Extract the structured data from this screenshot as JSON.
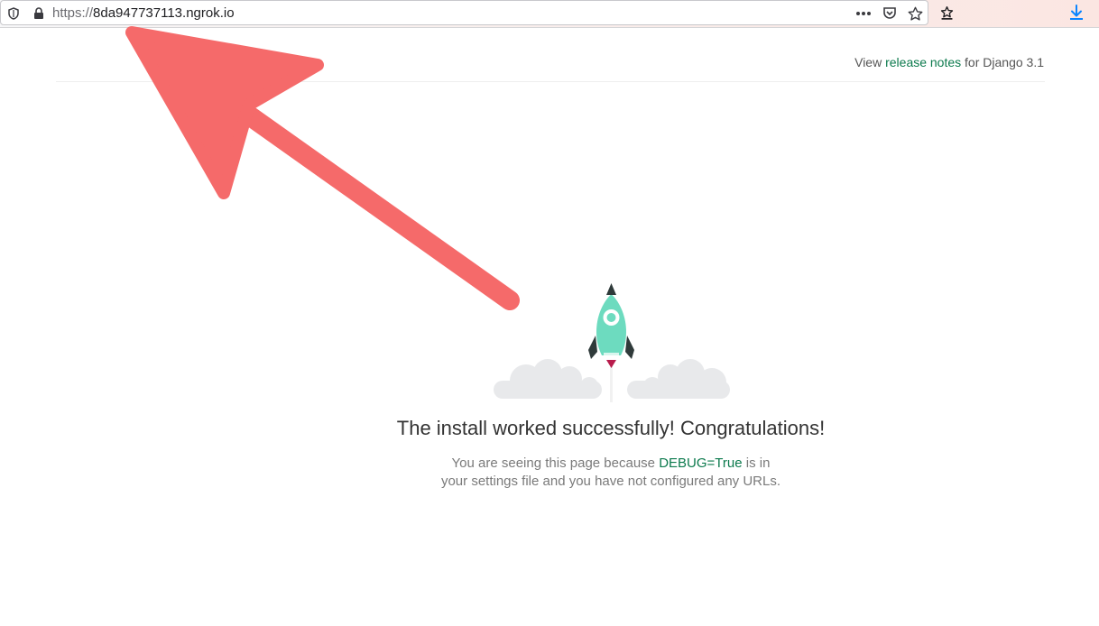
{
  "browser": {
    "url_scheme": "https://",
    "url_host": "8da947737113.ngrok.io",
    "icons": [
      "shield-icon",
      "lock-icon",
      "more-actions-icon",
      "pocket-icon",
      "bookmark-star-icon",
      "reading-list-icon",
      "download-icon"
    ]
  },
  "header": {
    "release_prefix": "View",
    "release_link": "release notes",
    "release_suffix": "for Django 3.1"
  },
  "main": {
    "title": "The install worked successfully! Congratulations!",
    "desc_before": "You are seeing this page because",
    "desc_link": "DEBUG=True",
    "desc_after": "is in your settings file and you have not configured any URLs."
  },
  "colors": {
    "link_green": "#0c7a4d",
    "rocket_teal": "#6ddbbf",
    "arrow_red": "#f56a6a"
  }
}
